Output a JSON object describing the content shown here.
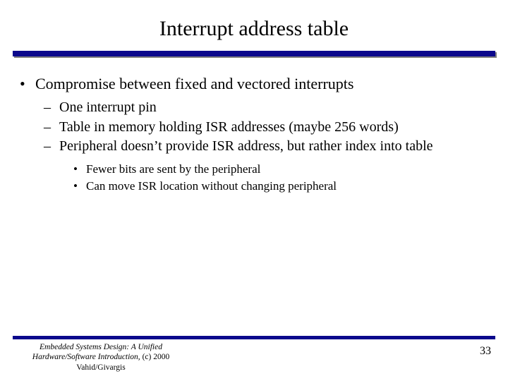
{
  "title": "Interrupt address table",
  "bullets": {
    "l1": "Compromise between fixed and vectored interrupts",
    "l2": [
      "One interrupt pin",
      "Table in memory holding ISR addresses (maybe 256 words)",
      "Peripheral doesn’t provide ISR address, but rather index into table"
    ],
    "l3": [
      "Fewer bits are sent by the peripheral",
      "Can move ISR location without changing peripheral"
    ]
  },
  "footer": {
    "line1": "Embedded Systems Design: A Unified",
    "line2_italic": "Hardware/Software Introduction, ",
    "line2_plain": "(c) 2000 Vahid/Givargis",
    "page": "33"
  },
  "markers": {
    "l1": "•",
    "l2": "–",
    "l3": "•"
  }
}
